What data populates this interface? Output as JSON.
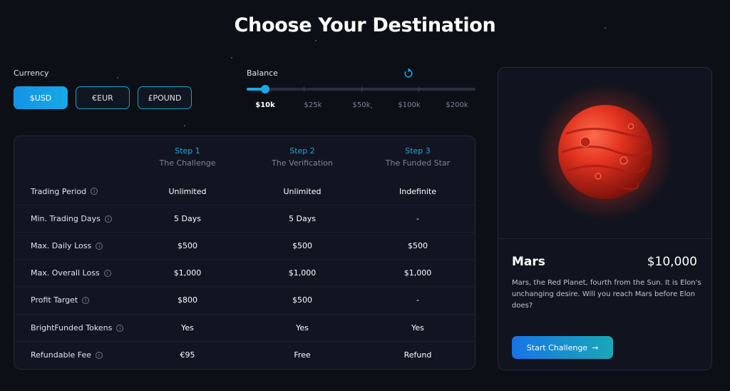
{
  "title": "Choose Your Destination",
  "currency": {
    "label": "Currency",
    "options": [
      "$USD",
      "€EUR",
      "£POUND"
    ],
    "selected": "$USD"
  },
  "balance": {
    "label": "Balance",
    "reset_icon": "reset-icon",
    "options": [
      "$10k",
      "$25k",
      "$50k",
      "$100k",
      "$200k"
    ],
    "selected": "$10k",
    "slider_fraction": 0.08
  },
  "table": {
    "steps": [
      {
        "num": "Step 1",
        "name": "The Challenge"
      },
      {
        "num": "Step 2",
        "name": "The Verification"
      },
      {
        "num": "Step 3",
        "name": "The Funded Star"
      }
    ],
    "rows": [
      {
        "label": "Trading Period",
        "values": [
          "Unlimited",
          "Unlimited",
          "Indefinite"
        ]
      },
      {
        "label": "Min. Trading Days",
        "values": [
          "5 Days",
          "5 Days",
          "-"
        ]
      },
      {
        "label": "Max. Daily Loss",
        "values": [
          "$500",
          "$500",
          "$500"
        ]
      },
      {
        "label": "Max. Overall Loss",
        "values": [
          "$1,000",
          "$1,000",
          "$1,000"
        ]
      },
      {
        "label": "Profit Target",
        "values": [
          "$800",
          "$500",
          "-"
        ]
      },
      {
        "label": "BrightFunded Tokens",
        "values": [
          "Yes",
          "Yes",
          "Yes"
        ]
      },
      {
        "label": "Refundable Fee",
        "values": [
          "€95",
          "Free",
          "Refund"
        ]
      }
    ],
    "info_icon": "i"
  },
  "planet": {
    "name": "Mars",
    "price": "$10,000",
    "description": "Mars, the Red Planet, fourth from the Sun. It is Elon's unchanging desire. Will you reach Mars before Elon does?",
    "button_label": "Start Challenge",
    "button_arrow": "→",
    "color": "#e0311f"
  },
  "colors": {
    "accent": "#1aa8e8",
    "background": "#0d0f17"
  }
}
